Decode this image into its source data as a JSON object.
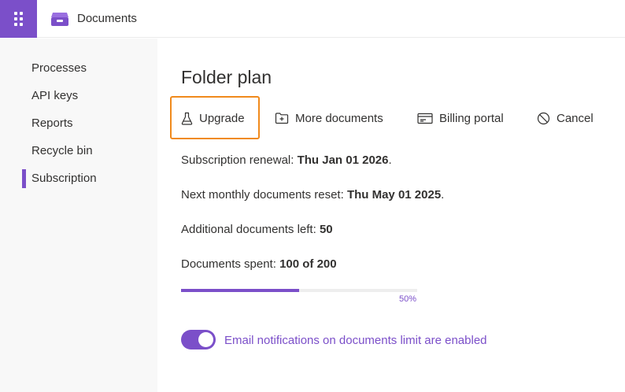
{
  "colors": {
    "accent": "#7b4fc9",
    "highlight": "#f08a1c"
  },
  "header": {
    "app_title": "Documents",
    "launcher_icon": "app-launcher-grid-icon",
    "app_icon": "archive-box-icon"
  },
  "sidebar": {
    "items": [
      {
        "label": "Processes",
        "active": false
      },
      {
        "label": "API keys",
        "active": false
      },
      {
        "label": "Reports",
        "active": false
      },
      {
        "label": "Recycle bin",
        "active": false
      },
      {
        "label": "Subscription",
        "active": true
      }
    ]
  },
  "main": {
    "title": "Folder plan",
    "toolbar": [
      {
        "label": "Upgrade",
        "icon": "flask-icon"
      },
      {
        "label": "More documents",
        "icon": "folder-add-icon"
      },
      {
        "label": "Billing portal",
        "icon": "billing-card-icon"
      },
      {
        "label": "Cancel",
        "icon": "cancel-circle-icon"
      }
    ],
    "renewal": {
      "label": "Subscription renewal: ",
      "value": "Thu Jan 01 2026",
      "suffix": "."
    },
    "reset": {
      "label": "Next monthly documents reset: ",
      "value": "Thu May 01 2025",
      "suffix": "."
    },
    "additional": {
      "label": "Additional documents left: ",
      "value": "50"
    },
    "spent": {
      "label": "Documents spent: ",
      "value": "100 of 200"
    },
    "progress": {
      "fraction": 0.5,
      "label": "50%"
    },
    "notifications": {
      "enabled": true,
      "label": "Email notifications on documents limit are enabled"
    }
  }
}
